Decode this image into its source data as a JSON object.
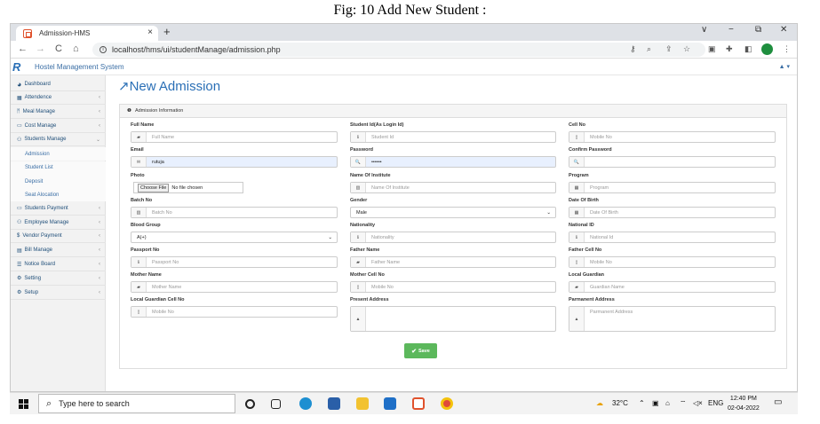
{
  "caption": "Fig: 10 Add New Student :",
  "browser": {
    "tab_title": "Admission-HMS",
    "tab_close": "×",
    "new_tab": "+",
    "url": "localhost/hms/ui/studentManage/admission.php",
    "back": "←",
    "forward": "→",
    "reload": "C",
    "home": "⌂",
    "win_chevron": "∨",
    "win_min": "−",
    "win_max": "⧉",
    "win_close": "✕",
    "menu": "⋮"
  },
  "app": {
    "logo_text": "R",
    "title": "Hostel Management System",
    "user_menu": "▲ ▾"
  },
  "sidebar": {
    "items": [
      {
        "label": "Dashboard",
        "icon": "dashboard-icon",
        "glyph": "◕"
      },
      {
        "label": "Attendence",
        "icon": "calendar-icon",
        "glyph": "▦"
      },
      {
        "label": "Meal Manage",
        "icon": "meal-icon",
        "glyph": "ᛗ"
      },
      {
        "label": "Cost Manage",
        "icon": "cost-icon",
        "glyph": "▭"
      },
      {
        "label": "Students Manage",
        "icon": "students-icon",
        "glyph": "⚇"
      },
      {
        "label": "Admission",
        "sub": true
      },
      {
        "label": "Student List",
        "sub": true
      },
      {
        "label": "Deposit",
        "sub": true
      },
      {
        "label": "Seat Alocation",
        "sub": true
      },
      {
        "label": "Students Payment",
        "icon": "payment-icon",
        "glyph": "▭"
      },
      {
        "label": "Employee Manage",
        "icon": "employee-icon",
        "glyph": "⚇"
      },
      {
        "label": "Vendor Payment",
        "icon": "dollar-icon",
        "glyph": "$"
      },
      {
        "label": "Bill Manage",
        "icon": "bill-icon",
        "glyph": "▤"
      },
      {
        "label": "Notice Board",
        "icon": "notice-icon",
        "glyph": "☰"
      },
      {
        "label": "Setting",
        "icon": "gear-icon",
        "glyph": "⚙"
      },
      {
        "label": "Setup",
        "icon": "gears-icon",
        "glyph": "⚙"
      }
    ],
    "chevron": "‹",
    "open_chevron": "⌄"
  },
  "page": {
    "title": "New Admission",
    "title_icon": "↗",
    "panel_title": "Admission Information",
    "panel_icon": "❶"
  },
  "form": {
    "full_name": {
      "label": "Full Name",
      "placeholder": "Full Name",
      "glyph": "▰"
    },
    "student_id": {
      "label": "Student Id(As Login Id)",
      "placeholder": "Student Id",
      "glyph": "ℹ"
    },
    "cell_no": {
      "label": "Cell No",
      "placeholder": "Mobile No",
      "glyph": "▯"
    },
    "email": {
      "label": "Email",
      "value": "rutuja",
      "glyph": "✉"
    },
    "password": {
      "label": "Password",
      "value": "••••••",
      "glyph": "🔍"
    },
    "confirm_password": {
      "label": "Confirm Password",
      "value": "",
      "glyph": "🔍"
    },
    "photo": {
      "label": "Photo",
      "button": "Choose File",
      "status": "No file chosen"
    },
    "institute": {
      "label": "Name Of Institute",
      "placeholder": "Name Of Institute",
      "glyph": "▥"
    },
    "program": {
      "label": "Program",
      "placeholder": "Program",
      "glyph": "▦"
    },
    "batch_no": {
      "label": "Batch No",
      "placeholder": "Batch No",
      "glyph": "▥"
    },
    "gender": {
      "label": "Gender",
      "value": "Male",
      "arrow": "⌄"
    },
    "dob": {
      "label": "Date Of Birth",
      "placeholder": "Date Of Birth",
      "glyph": "▦"
    },
    "blood_group": {
      "label": "Blood Group",
      "value": "A(+)",
      "arrow": "⌄"
    },
    "nationality": {
      "label": "Nationality",
      "placeholder": "Nationality",
      "glyph": "ℹ"
    },
    "national_id": {
      "label": "National ID",
      "placeholder": "National Id",
      "glyph": "ℹ"
    },
    "passport_no": {
      "label": "Passport No",
      "placeholder": "Passport No",
      "glyph": "ℹ"
    },
    "father_name": {
      "label": "Father Name",
      "placeholder": "Father Name",
      "glyph": "▰"
    },
    "father_cell": {
      "label": "Father Cell No",
      "placeholder": "Mobile No",
      "glyph": "▯"
    },
    "mother_name": {
      "label": "Mother Name",
      "placeholder": "Mother Name",
      "glyph": "▰"
    },
    "mother_cell": {
      "label": "Mother Cell No",
      "placeholder": "Mobile No",
      "glyph": "▯"
    },
    "local_guardian": {
      "label": "Local Guardian",
      "placeholder": "Guardian Name",
      "glyph": "▰"
    },
    "guardian_cell": {
      "label": "Local Guardian Cell No",
      "placeholder": "Mobile No",
      "glyph": "▯"
    },
    "present_address": {
      "label": "Present Address",
      "placeholder": "",
      "glyph": "▲"
    },
    "permanent_address": {
      "label": "Parmanent Address",
      "placeholder": "Parmanent Address",
      "glyph": "▲"
    },
    "save": "Save",
    "save_glyph": "✔"
  },
  "taskbar": {
    "search_placeholder": "Type here to search",
    "search_glyph": "⌕",
    "weather": "32°C",
    "lang": "ENG",
    "time": "12:40 PM",
    "date": "02-04-2022"
  },
  "colors": {
    "accent": "#2a6fb6",
    "save": "#5cb85c",
    "autofill": "#e8f0fe"
  }
}
